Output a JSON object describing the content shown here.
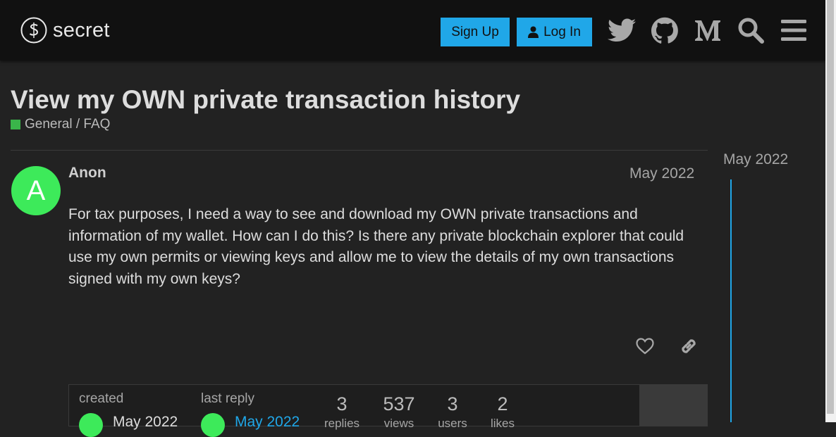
{
  "header": {
    "logo_text": "secret",
    "signup_label": "Sign Up",
    "login_label": "Log In",
    "icons": [
      "twitter-icon",
      "github-icon",
      "medium-icon",
      "search-icon",
      "menu-icon"
    ]
  },
  "topic": {
    "title": "View my OWN private transaction history",
    "category": "General / FAQ",
    "category_color": "#3ab54a"
  },
  "post": {
    "avatar_letter": "A",
    "avatar_color": "#3dea5a",
    "username": "Anon",
    "date": "May 2022",
    "body": "For tax purposes, I need a way to see and download my OWN private transactions and information of my wallet. How can I do this? Is there any private blockchain explorer that could use my own permits or viewing keys and allow me to view the details of my own transactions signed with my own keys?"
  },
  "summary": {
    "created_label": "created",
    "created_date": "May 2022",
    "last_reply_label": "last reply",
    "last_reply_date": "May 2022",
    "replies_count": "3",
    "replies_label": "replies",
    "views_count": "537",
    "views_label": "views",
    "users_count": "3",
    "users_label": "users",
    "likes_count": "2",
    "likes_label": "likes"
  },
  "timeline": {
    "date": "May 2022",
    "accent_color": "#20a7e8"
  }
}
